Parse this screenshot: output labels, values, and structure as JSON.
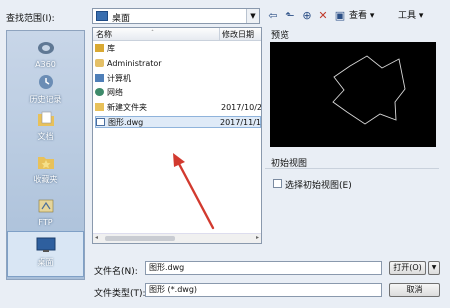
{
  "lookin": {
    "label": "查找范围(I):",
    "value": "桌面"
  },
  "toolbar": {
    "view_label": "查看",
    "tools_label": "工具"
  },
  "places": [
    {
      "label": "A360"
    },
    {
      "label": "历史记录"
    },
    {
      "label": "文档"
    },
    {
      "label": "收藏夹"
    },
    {
      "label": "FTP"
    },
    {
      "label": "桌面"
    }
  ],
  "filelist": {
    "col_name": "名称",
    "col_date": "修改日期",
    "rows": [
      {
        "name": "库",
        "date": "",
        "icon": "library-icon"
      },
      {
        "name": "Administrator",
        "date": "",
        "icon": "user-folder-icon"
      },
      {
        "name": "计算机",
        "date": "",
        "icon": "computer-icon"
      },
      {
        "name": "网络",
        "date": "",
        "icon": "network-icon"
      },
      {
        "name": "新建文件夹",
        "date": "2017/10/2",
        "icon": "folder-icon"
      },
      {
        "name": "图形.dwg",
        "date": "2017/11/1",
        "icon": "dwg-file-icon"
      }
    ]
  },
  "preview": {
    "label": "预览"
  },
  "initial_view": {
    "label": "初始视图",
    "checkbox_label": "选择初始视图(E)"
  },
  "filename": {
    "label": "文件名(N):",
    "value": "图形.dwg"
  },
  "filetype": {
    "label": "文件类型(T):",
    "value": "图形 (*.dwg)"
  },
  "buttons": {
    "open": "打开(O)",
    "cancel": "取消"
  },
  "colors": {
    "selection": "#dfeaf7",
    "places_bg": "#b7c9e0",
    "annotation_arrow": "#d23a2f"
  }
}
